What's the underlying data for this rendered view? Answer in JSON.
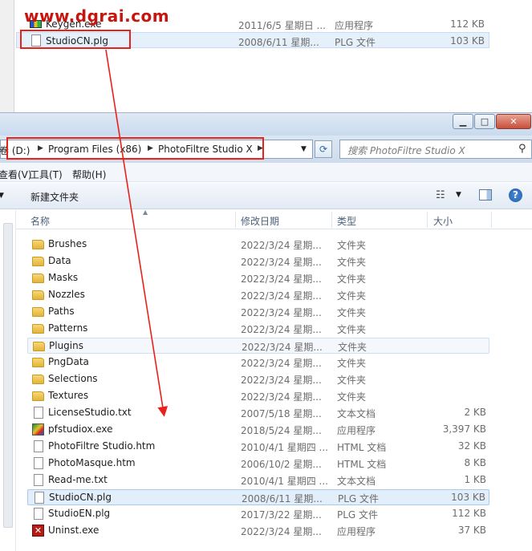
{
  "watermark": "www.dgrai.com",
  "top_window": {
    "rows": [
      {
        "name": "Keygen.exe",
        "date": "2011/6/5 星期日 ...",
        "type": "应用程序",
        "size": "112 KB",
        "icon": "keygen-icon"
      },
      {
        "name": "StudioCN.plg",
        "date": "2008/6/11 星期...",
        "type": "PLG 文件",
        "size": "103 KB",
        "icon": "document-icon"
      }
    ]
  },
  "window_controls": {
    "minimize": "▁",
    "maximize": "□",
    "close": "✕"
  },
  "address": {
    "crumbs": [
      "卷 (D:)",
      "Program Files (x86)",
      "PhotoFiltre Studio X"
    ],
    "search_placeholder": "搜索 PhotoFiltre Studio X"
  },
  "menu": {
    "view": "查看(V)",
    "tools": "工具(T)",
    "help": "帮助(H)"
  },
  "toolbar": {
    "new_folder": "新建文件夹"
  },
  "columns": {
    "name": "名称",
    "date": "修改日期",
    "type": "类型",
    "size": "大小"
  },
  "files": [
    {
      "name": "Brushes",
      "date": "2022/3/24 星期...",
      "type": "文件夹",
      "size": "",
      "kind": "folder"
    },
    {
      "name": "Data",
      "date": "2022/3/24 星期...",
      "type": "文件夹",
      "size": "",
      "kind": "folder"
    },
    {
      "name": "Masks",
      "date": "2022/3/24 星期...",
      "type": "文件夹",
      "size": "",
      "kind": "folder"
    },
    {
      "name": "Nozzles",
      "date": "2022/3/24 星期...",
      "type": "文件夹",
      "size": "",
      "kind": "folder"
    },
    {
      "name": "Paths",
      "date": "2022/3/24 星期...",
      "type": "文件夹",
      "size": "",
      "kind": "folder"
    },
    {
      "name": "Patterns",
      "date": "2022/3/24 星期...",
      "type": "文件夹",
      "size": "",
      "kind": "folder"
    },
    {
      "name": "Plugins",
      "date": "2022/3/24 星期...",
      "type": "文件夹",
      "size": "",
      "kind": "folder"
    },
    {
      "name": "PngData",
      "date": "2022/3/24 星期...",
      "type": "文件夹",
      "size": "",
      "kind": "folder"
    },
    {
      "name": "Selections",
      "date": "2022/3/24 星期...",
      "type": "文件夹",
      "size": "",
      "kind": "folder"
    },
    {
      "name": "Textures",
      "date": "2022/3/24 星期...",
      "type": "文件夹",
      "size": "",
      "kind": "folder"
    },
    {
      "name": "LicenseStudio.txt",
      "date": "2007/5/18 星期...",
      "type": "文本文档",
      "size": "2 KB",
      "kind": "doc"
    },
    {
      "name": "pfstudiox.exe",
      "date": "2018/5/24 星期...",
      "type": "应用程序",
      "size": "3,397 KB",
      "kind": "exe"
    },
    {
      "name": "PhotoFiltre Studio.htm",
      "date": "2010/4/1 星期四 ...",
      "type": "HTML 文档",
      "size": "32 KB",
      "kind": "doc"
    },
    {
      "name": "PhotoMasque.htm",
      "date": "2006/10/2 星期...",
      "type": "HTML 文档",
      "size": "8 KB",
      "kind": "doc"
    },
    {
      "name": "Read-me.txt",
      "date": "2010/4/1 星期四 ...",
      "type": "文本文档",
      "size": "1 KB",
      "kind": "doc"
    },
    {
      "name": "StudioCN.plg",
      "date": "2008/6/11 星期...",
      "type": "PLG 文件",
      "size": "103 KB",
      "kind": "doc"
    },
    {
      "name": "StudioEN.plg",
      "date": "2017/3/22 星期...",
      "type": "PLG 文件",
      "size": "112 KB",
      "kind": "doc"
    },
    {
      "name": "Uninst.exe",
      "date": "2022/3/24 星期...",
      "type": "应用程序",
      "size": "37 KB",
      "kind": "uninst"
    }
  ],
  "colors": {
    "highlight_red": "#e8221a",
    "selection": "#e3eefb",
    "watermark": "#c8140e"
  }
}
